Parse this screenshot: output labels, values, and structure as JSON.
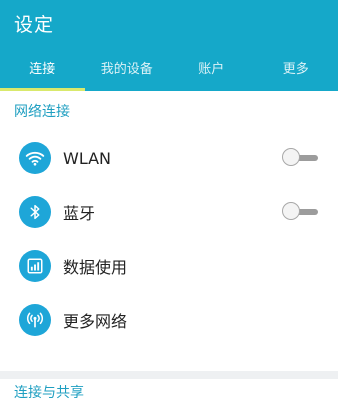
{
  "header": {
    "title": "设定",
    "background": "#15a8c9",
    "tab_indicator_color": "#d9e96c"
  },
  "tabs": [
    {
      "label": "连接",
      "active": true
    },
    {
      "label": "我的设备",
      "active": false
    },
    {
      "label": "账户",
      "active": false
    },
    {
      "label": "更多",
      "active": false
    }
  ],
  "sections": {
    "connections": {
      "title": "网络连接"
    },
    "connect_share": {
      "title": "连接与共享"
    }
  },
  "items": [
    {
      "label": "WLAN",
      "icon": "wifi-icon",
      "toggle": "off"
    },
    {
      "label": "蓝牙",
      "icon": "bluetooth-icon",
      "toggle": "off"
    },
    {
      "label": "数据使用",
      "icon": "data-usage-icon"
    },
    {
      "label": "更多网络",
      "icon": "more-networks-icon"
    }
  ],
  "colors": {
    "icon_circle": "#1ea6d8",
    "section_header": "#1f9fc1"
  }
}
